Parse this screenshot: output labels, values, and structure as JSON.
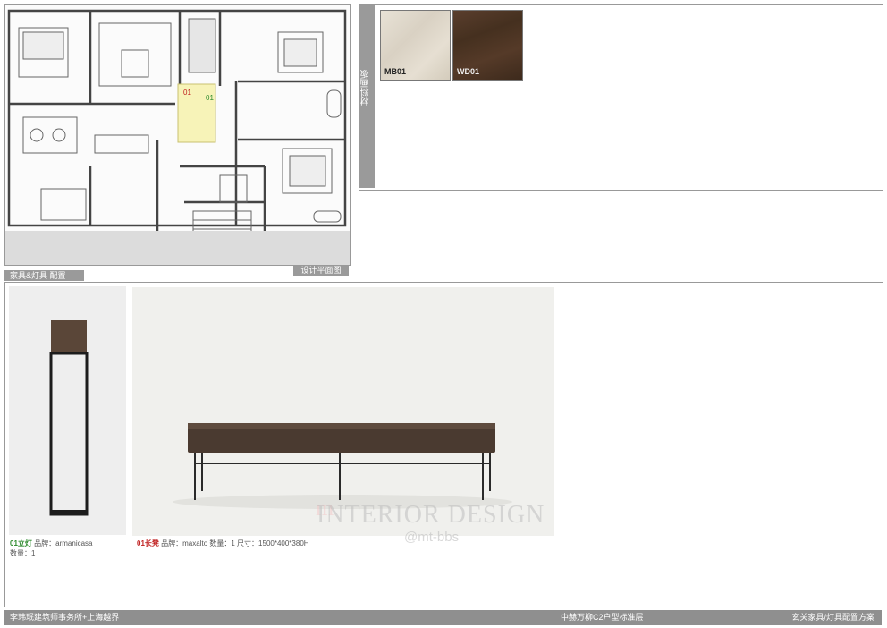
{
  "plan": {
    "label": "设计平面图",
    "marker_left": "01",
    "marker_right": "01"
  },
  "materials": {
    "panel_label": "材料画板",
    "swatches": [
      {
        "code": "MB01",
        "color": "#e2dbcf"
      },
      {
        "code": "WD01",
        "color": "#4e3526"
      }
    ]
  },
  "furniture": {
    "section_label": "家具&灯具 配置",
    "lamp": {
      "name": "01立灯",
      "name_color": "#2c8a2c",
      "details": "品牌：armanicasa",
      "qty": "数量：1"
    },
    "bench": {
      "name": "01长凳",
      "name_color": "#c02020",
      "details": "品牌：maxalto   数量：1   尺寸：1500*400*380H"
    },
    "watermark_1": "INTERIOR DESIGN",
    "watermark_2": "@mt-bbs"
  },
  "footer": {
    "left": "李玮珉建筑师事务所+上海越界",
    "center": "中赫万柳C2户型标准层",
    "right": "玄关家具/灯具配置方案"
  }
}
